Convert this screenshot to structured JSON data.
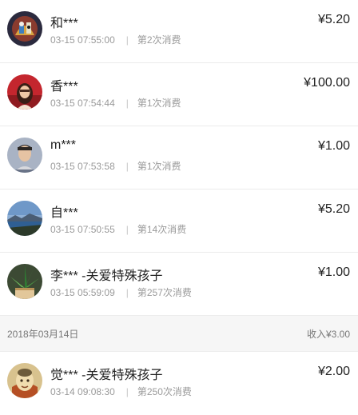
{
  "currency_symbol": "¥",
  "entries": [
    {
      "name": "和***",
      "time": "03-15 07:55:00",
      "count_label": "第2次消费",
      "amount": "¥5.20",
      "avatar_icon": "colorful-portrait-avatar-icon"
    },
    {
      "name": "香***",
      "time": "03-15 07:54:44",
      "count_label": "第1次消费",
      "amount": "¥100.00",
      "avatar_icon": "woman-red-avatar-icon"
    },
    {
      "name": "m***",
      "time": "03-15 07:53:58",
      "count_label": "第1次消费",
      "amount": "¥1.00",
      "avatar_icon": "man-selfie-avatar-icon"
    },
    {
      "name": "自***",
      "time": "03-15 07:50:55",
      "count_label": "第14次消费",
      "amount": "¥5.20",
      "avatar_icon": "lake-landscape-avatar-icon"
    }
  ],
  "entry5": {
    "name": "李*** -关爱特殊孩子",
    "time": "03-15 05:59:09",
    "count_label": "第257次消费",
    "amount": "¥1.00",
    "avatar_icon": "plant-pot-avatar-icon"
  },
  "date_group": {
    "date": "2018年03月14日",
    "income_label": "收入",
    "income_amount": "¥3.00"
  },
  "entry6": {
    "name": "觉*** -关爱特殊孩子",
    "time": "03-14 09:08:30",
    "count_label": "第250次消费",
    "amount": "¥2.00",
    "avatar_icon": "buddha-avatar-icon"
  },
  "separator": "|"
}
